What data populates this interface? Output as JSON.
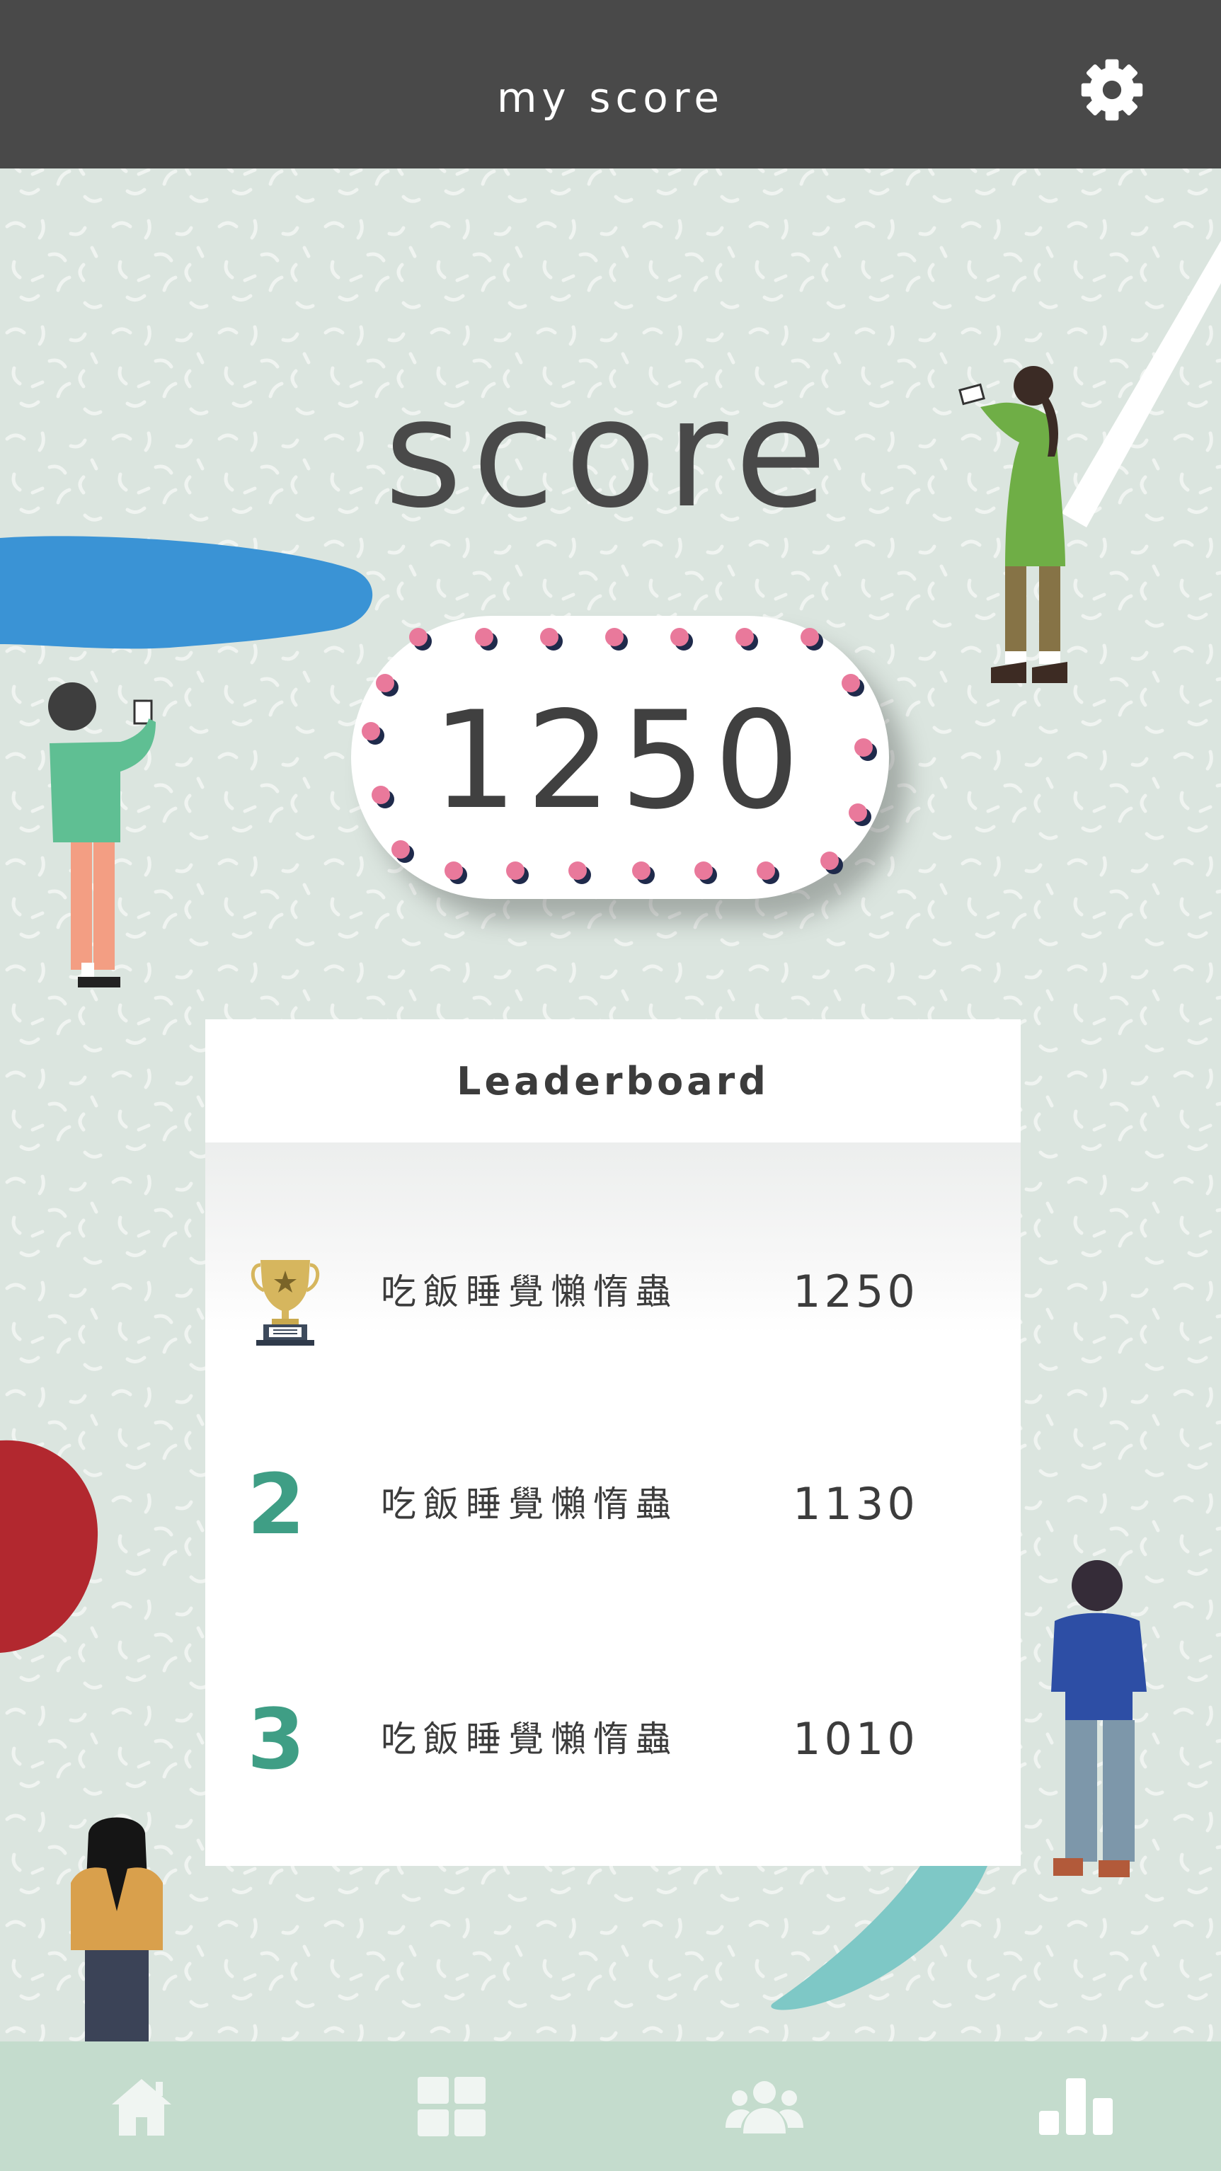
{
  "header": {
    "title": "my score",
    "settings_icon": "gear-icon"
  },
  "score": {
    "heading": "score",
    "value": "1250"
  },
  "leaderboard": {
    "title": "Leaderboard",
    "rows": [
      {
        "rank_icon": "trophy-icon",
        "name": "吃飯睡覺懶惰蟲",
        "score": "1250"
      },
      {
        "rank": "2",
        "name": "吃飯睡覺懶惰蟲",
        "score": "1130"
      },
      {
        "rank": "3",
        "name": "吃飯睡覺懶惰蟲",
        "score": "1010"
      }
    ]
  },
  "bottom_nav": {
    "items": [
      {
        "icon": "home-icon"
      },
      {
        "icon": "grid-icon"
      },
      {
        "icon": "users-icon"
      },
      {
        "icon": "bar-chart-icon",
        "active": true
      }
    ]
  },
  "colors": {
    "header_bg": "#494949",
    "background": "#dbe5df",
    "accent_green": "#3f9e85",
    "nav_bg": "#c4dccd",
    "dot_pink": "#e9799b",
    "dot_navy": "#1f2a4b"
  }
}
